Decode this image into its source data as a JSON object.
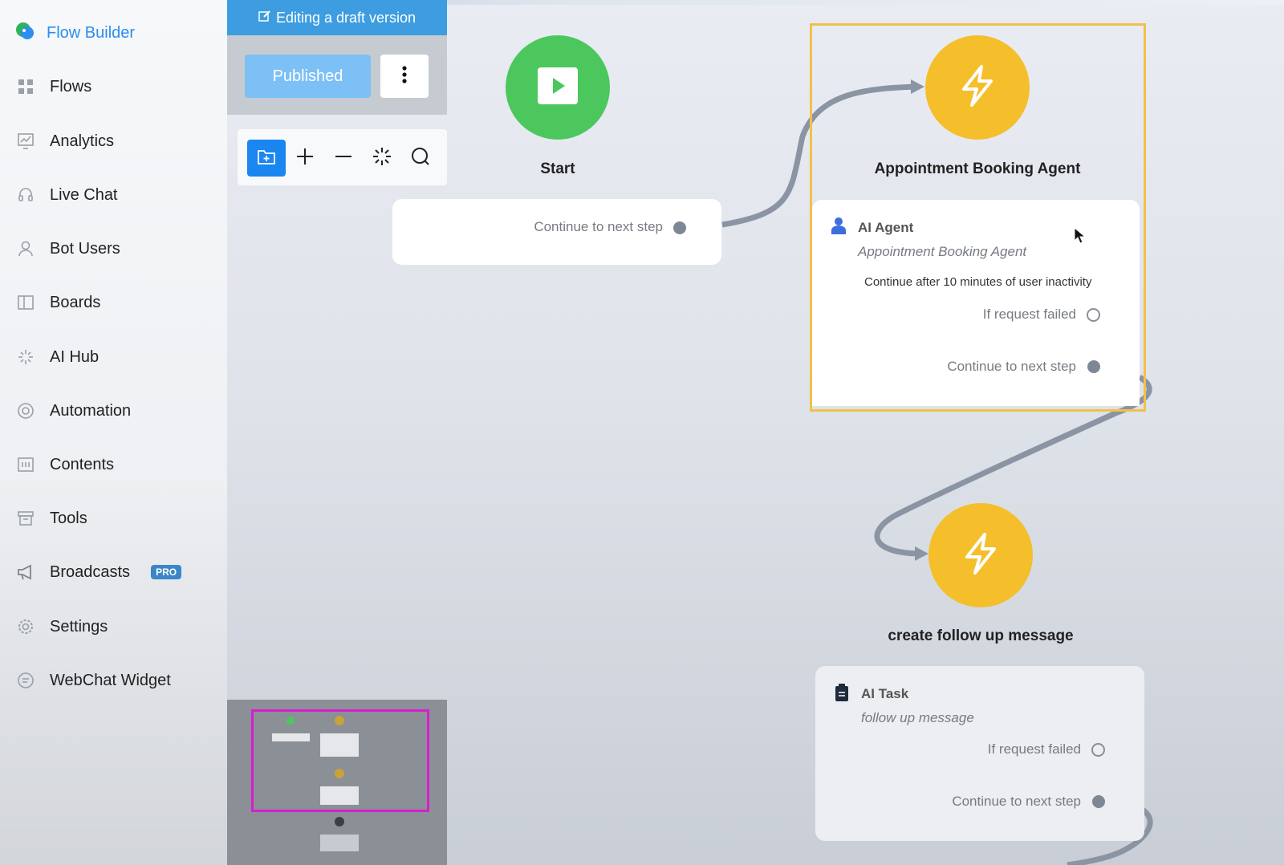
{
  "sidebar": {
    "brand": "Flow Builder",
    "items": [
      {
        "label": "Flows",
        "icon": "grid-icon"
      },
      {
        "label": "Analytics",
        "icon": "analytics-icon"
      },
      {
        "label": "Live Chat",
        "icon": "headset-icon"
      },
      {
        "label": "Bot Users",
        "icon": "user-icon"
      },
      {
        "label": "Boards",
        "icon": "board-icon"
      },
      {
        "label": "AI Hub",
        "icon": "sparkle-icon"
      },
      {
        "label": "Automation",
        "icon": "automation-icon"
      },
      {
        "label": "Contents",
        "icon": "contents-icon"
      },
      {
        "label": "Tools",
        "icon": "archive-icon"
      },
      {
        "label": "Broadcasts",
        "icon": "megaphone-icon",
        "badge": "PRO"
      },
      {
        "label": "Settings",
        "icon": "gear-icon"
      },
      {
        "label": "WebChat Widget",
        "icon": "chat-bubble-icon"
      }
    ]
  },
  "toolbar": {
    "draft_banner": "Editing a draft version",
    "published_label": "Published"
  },
  "nodes": {
    "start": {
      "title": "Start",
      "next_label": "Continue to next step"
    },
    "agent": {
      "title": "Appointment Booking Agent",
      "type_label": "AI Agent",
      "subtitle": "Appointment Booking Agent",
      "inactivity": "Continue after 10 minutes of user inactivity",
      "fail_label": "If request failed",
      "next_label": "Continue to next step"
    },
    "followup": {
      "title": "create follow up message",
      "type_label": "AI Task",
      "subtitle": "follow up message",
      "fail_label": "If request failed",
      "next_label": "Continue to next step"
    }
  },
  "colors": {
    "accent": "#1a86f0",
    "start_green": "#4cc75d",
    "action_yellow": "#f5be2b",
    "selection": "#f2c04a",
    "minimap_frame": "#d61ecf"
  }
}
